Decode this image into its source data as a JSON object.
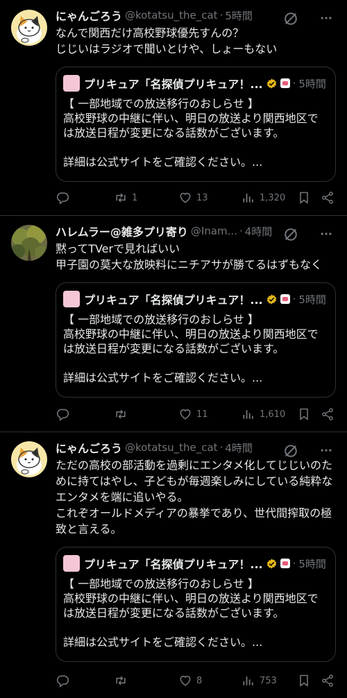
{
  "tweets": [
    {
      "display_name": "にゃんごろう",
      "handle": "@kotatsu_the_cat",
      "dot": "·",
      "time": "5時間",
      "text": "なんで関西だけ高校野球優先すんの？\nじじいはラジオで聞いとけや、しょーもない",
      "quote": {
        "name": "プリキュア「名探偵プリキュア！...",
        "dot": "·",
        "time": "5時間",
        "text": "【 一部地域での放送移行のおしらせ 】\n高校野球の中継に伴い、明日の放送より関西地区では放送日程が変更になる話数がございます。\n\n詳細は公式サイトをご確認ください。..."
      },
      "actions": {
        "replies": "",
        "retweets": "1",
        "likes": "13",
        "views": "1,320"
      }
    },
    {
      "display_name": "ハレムラー@雑多プリ寄り",
      "handle": "@Inam...",
      "dot": "·",
      "time": "4時間",
      "text": "黙ってTVerで見ればいい\n甲子園の莫大な放映料にニチアサが勝てるはずもなく",
      "quote": {
        "name": "プリキュア「名探偵プリキュア！...",
        "dot": "·",
        "time": "5時間",
        "text": "【 一部地域での放送移行のおしらせ 】\n高校野球の中継に伴い、明日の放送より関西地区では放送日程が変更になる話数がございます。\n\n詳細は公式サイトをご確認ください。..."
      },
      "actions": {
        "replies": "",
        "retweets": "",
        "likes": "11",
        "views": "1,610"
      }
    },
    {
      "display_name": "にゃんごろう",
      "handle": "@kotatsu_the_cat",
      "dot": "·",
      "time": "4時間",
      "text": "ただの高校の部活動を過剰にエンタメ化してじじいのために持てはやし、子どもが毎週楽しみにしている純粋なエンタメを端に追いやる。\nこれぞオールドメディアの暴挙であり、世代間搾取の極致と言える。",
      "quote": {
        "name": "プリキュア「名探偵プリキュア！...",
        "dot": "·",
        "time": "5時間",
        "text": "【 一部地域での放送移行のおしらせ 】\n高校野球の中継に伴い、明日の放送より関西地区では放送日程が変更になる話数がございます。\n\n詳細は公式サイトをご確認ください。..."
      },
      "actions": {
        "replies": "",
        "retweets": "",
        "likes": "8",
        "views": "753"
      }
    }
  ],
  "colors": {
    "background": "#000000",
    "text": "#e7e9ea",
    "muted": "#71767b",
    "border": "#2f3336",
    "verified": "#e2b719"
  },
  "icons": [
    "grok-icon",
    "more-icon",
    "reply-icon",
    "retweet-icon",
    "like-icon",
    "views-icon",
    "bookmark-icon",
    "share-icon",
    "verified-badge-icon",
    "affiliate-badge-icon"
  ]
}
